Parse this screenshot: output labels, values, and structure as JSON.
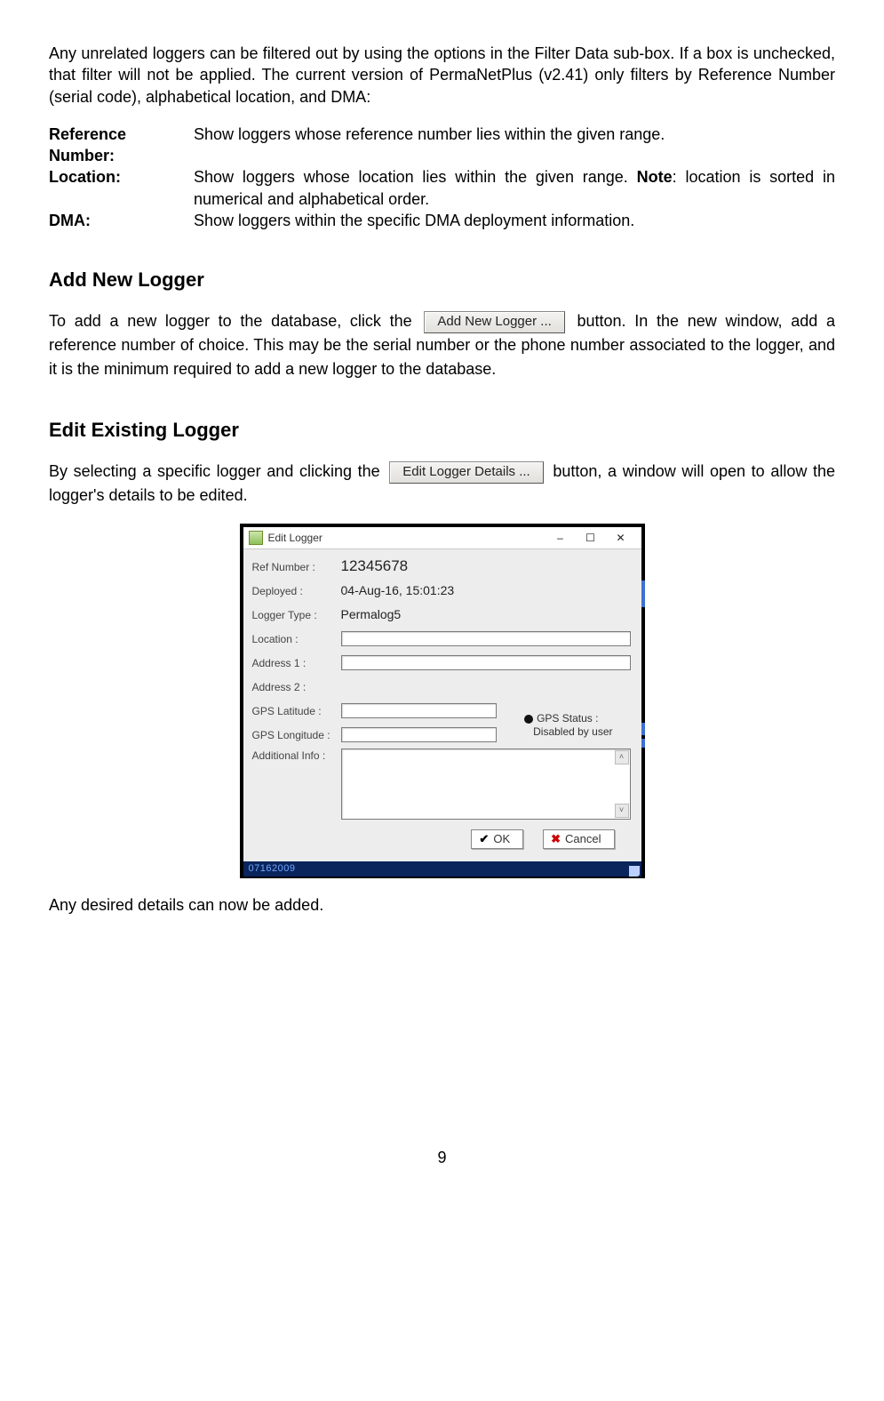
{
  "intro_paragraph": "Any unrelated loggers can be filtered out by using the options in the Filter Data sub-box. If a box is unchecked, that filter will not be applied. The current version of PermaNetPlus (v2.41) only filters by Reference Number (serial code), alphabetical location, and DMA:",
  "definitions": {
    "ref_label": "Reference Number:",
    "ref_desc": "Show loggers whose reference number lies within the given range.",
    "loc_label": "Location:",
    "loc_desc_pre": "Show loggers whose location lies within the given range. ",
    "loc_desc_bold": "Note",
    "loc_desc_post": ": location is sorted in numerical and alphabetical order.",
    "dma_label": "DMA:",
    "dma_desc": "Show loggers within the specific DMA deployment information."
  },
  "section_add": {
    "heading": "Add New Logger",
    "para_pre": "To add a new logger to the database, click the ",
    "button_label": "Add New Logger ...",
    "para_post": " button. In the new window, add a reference number of choice. This may be the serial number or the phone number associated to the logger, and it is the minimum required to add a new logger to the database."
  },
  "section_edit": {
    "heading": "Edit Existing Logger",
    "para_pre": "By selecting a specific logger and clicking the ",
    "button_label": "Edit Logger Details ...",
    "para_post": " button, a window will open to allow the logger's details to be edited."
  },
  "dialog": {
    "title": "Edit Logger",
    "fields": {
      "ref_label": "Ref Number :",
      "ref_value": "12345678",
      "deployed_label": "Deployed :",
      "deployed_value": "04-Aug-16, 15:01:23",
      "type_label": "Logger Type :",
      "type_value": "Permalog5",
      "location_label": "Location :",
      "addr1_label": "Address 1 :",
      "addr2_label": "Address 2 :",
      "gps_lat_label": "GPS Latitude :",
      "gps_lon_label": "GPS Longitude :",
      "addl_label": "Additional Info :"
    },
    "gps_status_label": "GPS Status :",
    "gps_status_value": "Disabled by user",
    "ok_label": "OK",
    "cancel_label": "Cancel",
    "bottom_strip_text": "07162009"
  },
  "closing_para": "Any desired details can now be added.",
  "page_number": "9"
}
